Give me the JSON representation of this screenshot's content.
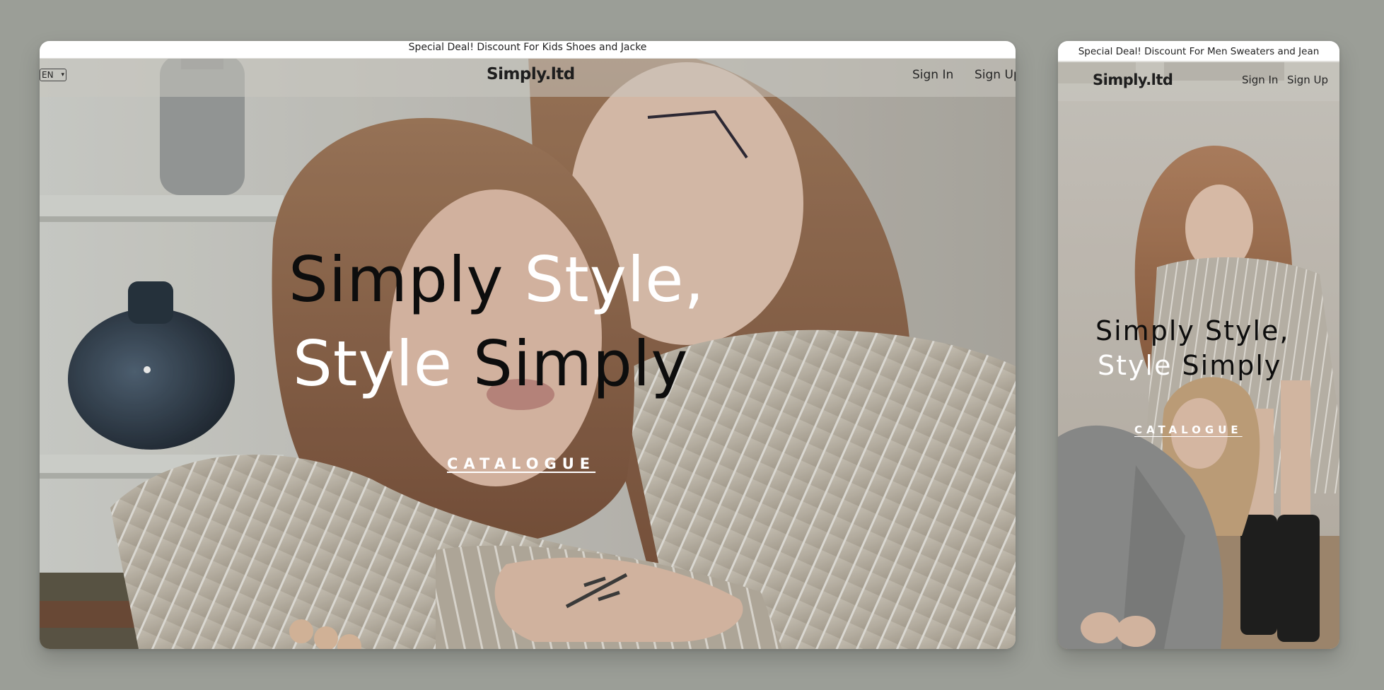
{
  "desktop": {
    "promo_text": "Special Deal! Discount For Kids Shoes and Jacke",
    "language": "EN",
    "logo": "Simply.ltd",
    "nav": {
      "sign_in": "Sign In",
      "sign_up": "Sign Up"
    },
    "hero": {
      "line1_dark": "Simply",
      "line1_light": "Style,",
      "line2_light": "Style",
      "line2_dark": "Simply"
    },
    "cta": "CATALOGUE"
  },
  "mobile": {
    "promo_text": "Special Deal! Discount For Men Sweaters and Jean",
    "logo": "Simply.ltd",
    "nav": {
      "sign_in": "Sign In",
      "sign_up": "Sign Up"
    },
    "hero": {
      "line1": "Simply Style,",
      "line2_light": "Style",
      "line2_dark": "Simply"
    },
    "cta": "CATALOGUE"
  },
  "colors": {
    "background": "#9b9e97",
    "promo_bar": "#ffffff",
    "hero_dark_text": "#0d0d0d",
    "hero_light_text": "#ffffff"
  }
}
